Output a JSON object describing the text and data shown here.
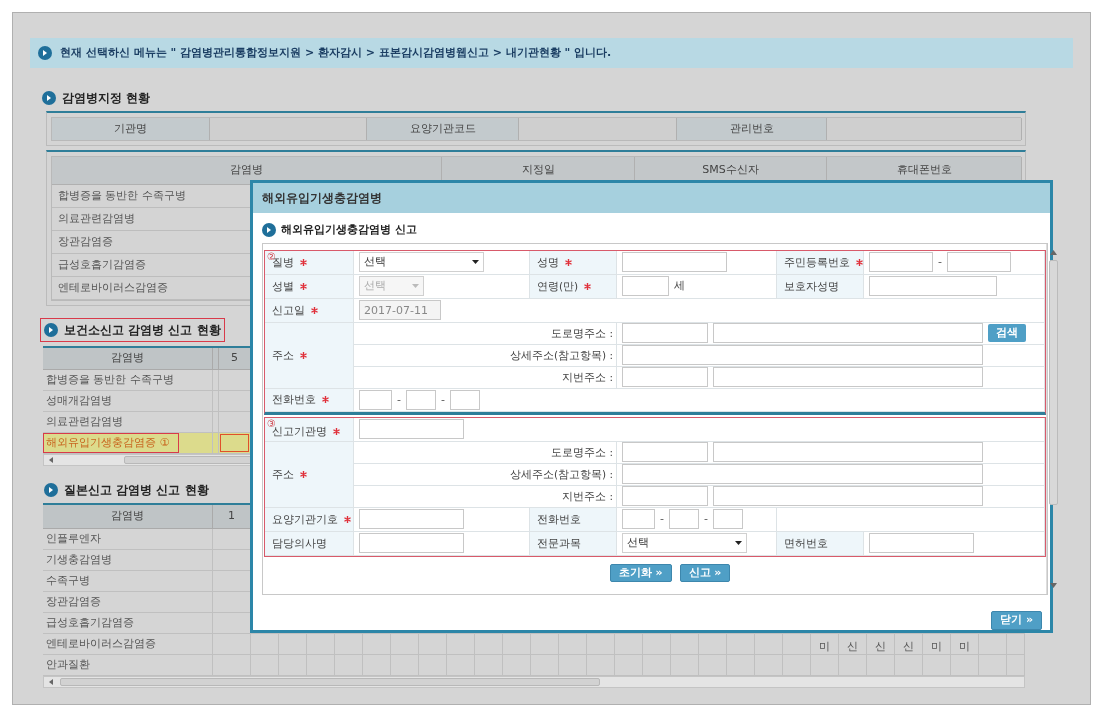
{
  "breadcrumb": "현재 선택하신 메뉴는 \" 감염병관리통합정보지원 > 환자감시 > 표본감시감염병웹신고 > 내기관현황 \" 입니다.",
  "designation": {
    "title": "감염병지정 현황",
    "info_labels": [
      "기관명",
      "요양기관코드",
      "관리번호"
    ],
    "columns": [
      "감염병",
      "지정일",
      "SMS수신자",
      "휴대폰번호"
    ],
    "rows": [
      "합병증을 동반한 수족구병",
      "의료관련감염병",
      "장관감염증",
      "급성호흡기감염증",
      "엔테로바이러스감염증"
    ]
  },
  "health_center": {
    "title": "보건소신고 감염병 신고 현황",
    "outlined": true,
    "columns": [
      "감염병",
      "5"
    ],
    "rows": [
      {
        "name": "합병증을 동반한 수족구병",
        "highlighted": false
      },
      {
        "name": "성매개감염병",
        "highlighted": false
      },
      {
        "name": "의료관련감염병",
        "highlighted": false
      },
      {
        "name": "해외유입기생충감염증 ①",
        "highlighted": true
      }
    ]
  },
  "kcdc": {
    "title": "질본신고 감염병 신고 현황",
    "columns": [
      "감염병",
      "1"
    ],
    "rows": [
      {
        "name": "인플루엔자"
      },
      {
        "name": "기생충감염병"
      },
      {
        "name": "수족구병"
      },
      {
        "name": "장관감염증"
      },
      {
        "name": "급성호흡기감염증"
      },
      {
        "name": "엔테로바이러스감염증",
        "marks": [
          "미",
          "신",
          "신",
          "신",
          "미",
          "미"
        ]
      },
      {
        "name": "안과질환"
      }
    ]
  },
  "modal": {
    "title": "해외유입기생충감염병",
    "section_title": "해외유입기생충감염병 신고",
    "patient": {
      "marker": "②",
      "disease": {
        "label": "질병",
        "required": true,
        "value": "선택",
        "disabled": false
      },
      "name": {
        "label": "성명",
        "required": true
      },
      "rrn": {
        "label": "주민등록번호",
        "required": true,
        "separator": "-"
      },
      "sex": {
        "label": "성별",
        "required": true,
        "value": "선택",
        "disabled": true
      },
      "age": {
        "label": "연령(만)",
        "required": true,
        "unit": "세"
      },
      "guardian": {
        "label": "보호자성명"
      },
      "report_date": {
        "label": "신고일",
        "required": true,
        "value": "2017-07-11",
        "disabled": true
      },
      "address": {
        "label": "주소",
        "required": true,
        "road": "도로명주소 :",
        "detail": "상세주소(참고항목) :",
        "lot": "지번주소 :",
        "search_button": "검색"
      },
      "phone": {
        "label": "전화번호",
        "required": true,
        "separator": "-"
      }
    },
    "facility": {
      "marker": "③",
      "name": {
        "label": "신고기관명",
        "required": true
      },
      "address": {
        "label": "주소",
        "required": true,
        "road": "도로명주소 :",
        "detail": "상세주소(참고항목) :",
        "lot": "지번주소 :"
      },
      "code": {
        "label": "요양기관기호",
        "required": true
      },
      "phone": {
        "label": "전화번호",
        "separator": "-"
      },
      "doctor": {
        "label": "담당의사명"
      },
      "specialty": {
        "label": "전문과목",
        "value": "선택",
        "disabled": false
      },
      "license": {
        "label": "면허번호"
      }
    },
    "buttons": [
      "초기화 »",
      "신고 »"
    ],
    "close": "닫기 »"
  }
}
